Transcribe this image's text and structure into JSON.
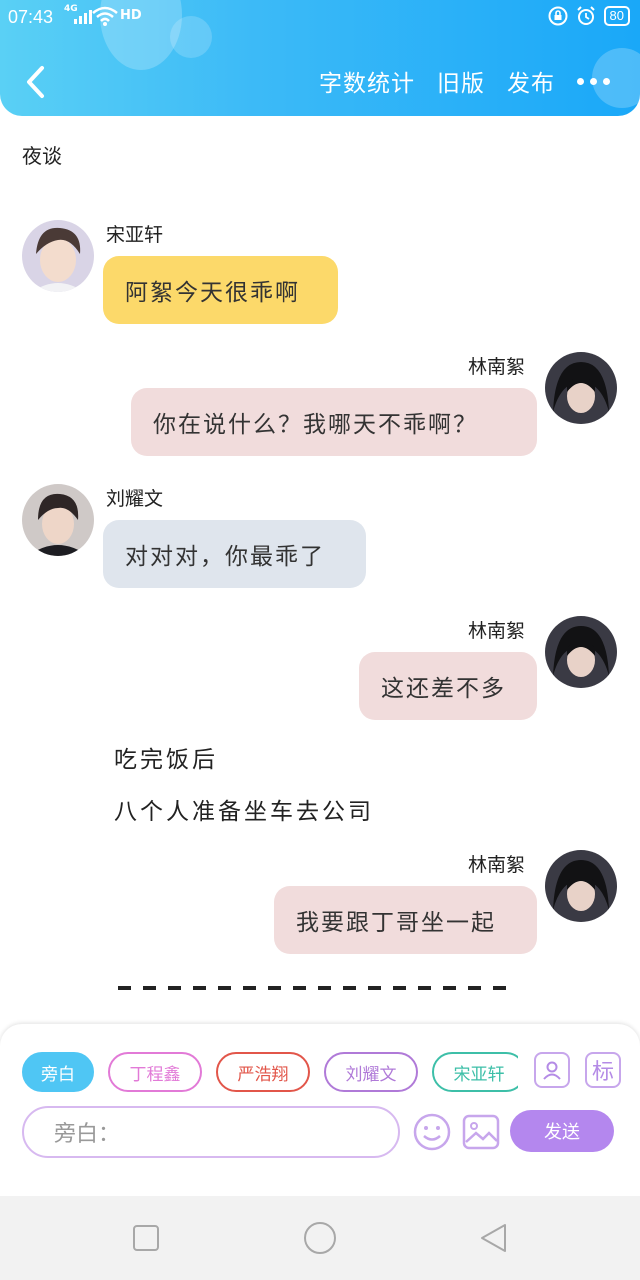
{
  "status_bar": {
    "time": "07:43",
    "network": "4G",
    "hd": "HD",
    "battery": "80"
  },
  "header": {
    "word_count": "字数统计",
    "old_version": "旧版",
    "publish": "发布"
  },
  "story": {
    "title": "夜谈"
  },
  "messages": [
    {
      "speaker": "宋亚轩",
      "text": "阿絮今天很乖啊"
    },
    {
      "speaker": "林南絮",
      "text": "你在说什么？我哪天不乖啊？"
    },
    {
      "speaker": "刘耀文",
      "text": "对对对，你最乖了"
    },
    {
      "speaker": "林南絮",
      "text": "这还差不多"
    },
    {
      "speaker": "林南絮",
      "text": "我要跟丁哥坐一起"
    }
  ],
  "narration": [
    "吃完饭后",
    "八个人准备坐车去公司"
  ],
  "composer": {
    "chips": [
      {
        "label": "旁白",
        "color": "#4fc6f4"
      },
      {
        "label": "丁程鑫",
        "color": "#e27ad7"
      },
      {
        "label": "严浩翔",
        "color": "#e2564a"
      },
      {
        "label": "刘耀文",
        "color": "#b07ad8"
      },
      {
        "label": "宋亚轩",
        "color": "#3dbfa8"
      }
    ],
    "mark_icon_label": "标",
    "input_placeholder": "旁白：",
    "send_label": "发送"
  }
}
